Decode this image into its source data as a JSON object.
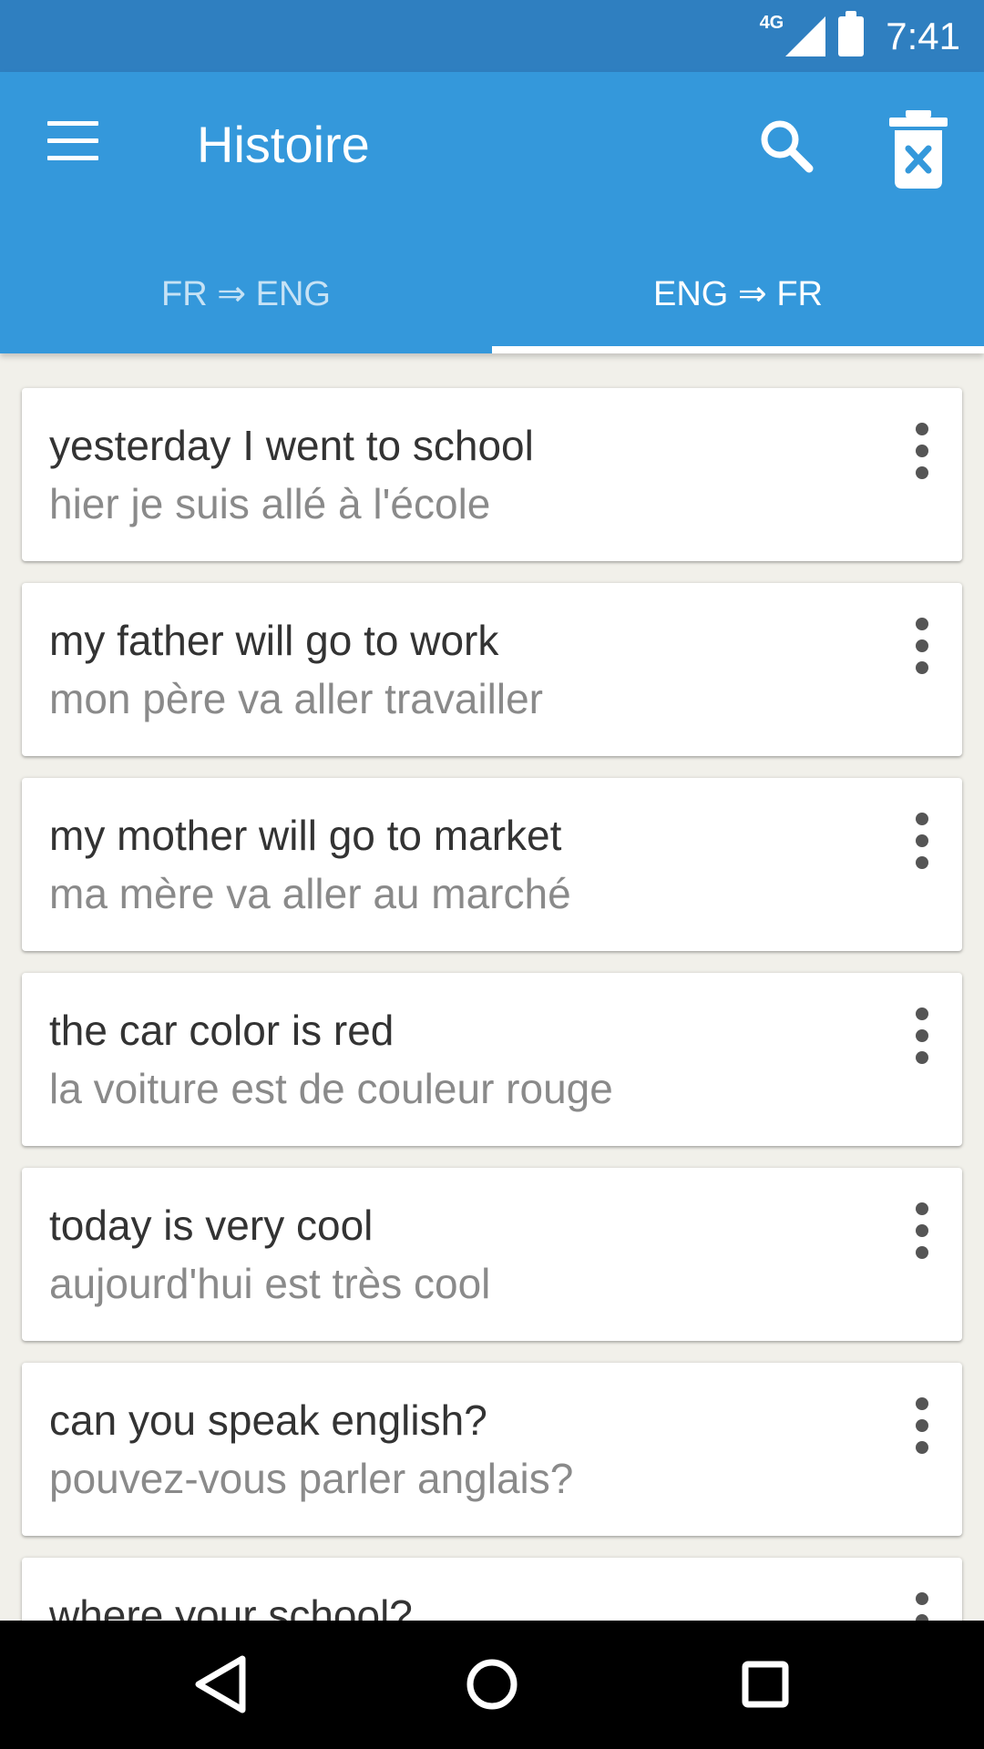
{
  "status_bar": {
    "network": "4G",
    "time": "7:41"
  },
  "app_bar": {
    "title": "Histoire",
    "menu_icon": "hamburger-menu-icon",
    "search_icon": "search-icon",
    "delete_icon": "trash-delete-icon"
  },
  "tabs": [
    {
      "label": "FR ⇒ ENG",
      "active": false
    },
    {
      "label": "ENG ⇒ FR",
      "active": true
    }
  ],
  "history": [
    {
      "source": "yesterday I went to school",
      "translation": "hier je suis allé à l'école"
    },
    {
      "source": "my father will go to work",
      "translation": "mon père va aller travailler"
    },
    {
      "source": "my mother will go to market",
      "translation": "ma mère va aller au marché"
    },
    {
      "source": "the car color is red",
      "translation": "la voiture est de couleur rouge"
    },
    {
      "source": "today is very cool",
      "translation": "aujourd'hui est très cool"
    },
    {
      "source": "can you speak english?",
      "translation": "pouvez-vous parler anglais?"
    },
    {
      "source": "where your school?",
      "translation": ""
    }
  ],
  "colors": {
    "status_bar": "#2f7fc0",
    "app_bar": "#3498db",
    "background": "#f1f0ea",
    "primary_text": "#333333",
    "secondary_text": "#8a8a8a"
  },
  "nav_bar": {
    "back_icon": "back-triangle-icon",
    "home_icon": "home-circle-icon",
    "recents_icon": "recents-square-icon"
  }
}
